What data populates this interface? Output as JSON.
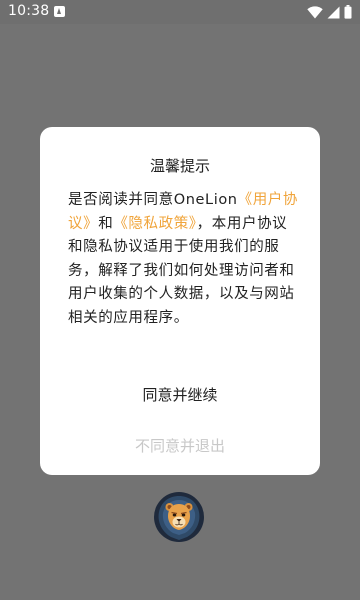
{
  "status_bar": {
    "time": "10:38",
    "icons": [
      "notification-icon",
      "wifi-icon",
      "signal-icon",
      "battery-icon"
    ]
  },
  "dialog": {
    "title": "温馨提示",
    "body_prefix": "是否阅读并同意OneLion",
    "user_agreement_link": "《用户协议》",
    "and_text": "和",
    "privacy_policy_link": "《隐私政策》",
    "body_suffix": "，本用户协议和隐私协议适用于使用我们的服务，解释了我们如何处理访问者和用户收集的个人数据，以及与网站相关的应用程序。",
    "agree_label": "同意并继续",
    "decline_label": "不同意并退出"
  },
  "colors": {
    "link": "#f0a43a",
    "overlay": "#737373",
    "decline_text": "#c8c8c8"
  },
  "logo": {
    "icon": "lion-logo-icon"
  }
}
